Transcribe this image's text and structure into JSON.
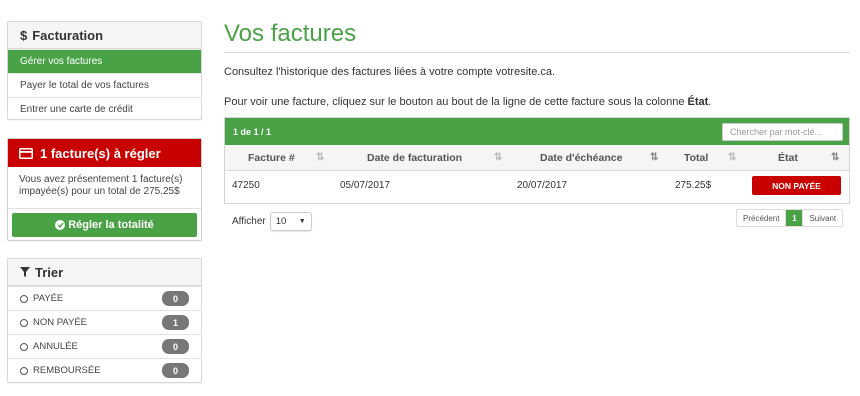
{
  "sidebar": {
    "billing": {
      "title": "Facturation",
      "items": [
        {
          "label": "Gérer vos factures",
          "active": true
        },
        {
          "label": "Payer le total de vos factures",
          "active": false
        },
        {
          "label": "Entrer une carte de crédit",
          "active": false
        }
      ]
    },
    "due": {
      "title": "1 facture(s) à régler",
      "message": "Vous avez présentement 1 facture(s) impayée(s) pour un total de 275.25$",
      "button_label": "Régler la totalité"
    },
    "filter": {
      "title": "Trier",
      "items": [
        {
          "label": "PAYÉE",
          "count": "0"
        },
        {
          "label": "NON PAYÉE",
          "count": "1"
        },
        {
          "label": "ANNULÉE",
          "count": "0"
        },
        {
          "label": "REMBOURSÉE",
          "count": "0"
        }
      ]
    }
  },
  "main": {
    "title": "Vos factures",
    "intro": "Consultez l'historique des factures liées à votre compte votresite.ca.",
    "instruction_prefix": "Pour voir une facture, cliquez sur le bouton au bout de la ligne de cette facture sous la colonne ",
    "instruction_bold": "État",
    "instruction_suffix": ".",
    "table": {
      "count_text": "1 de 1 / 1",
      "search_placeholder": "Chercher par mot-clé...",
      "headers": {
        "invoice": "Facture #",
        "billing_date": "Date de facturation",
        "due_date": "Date d'échéance",
        "total": "Total",
        "status": "État"
      },
      "rows": [
        {
          "invoice": "47250",
          "billing_date": "05/07/2017",
          "due_date": "20/07/2017",
          "total": "275.25$",
          "status": "NON PAYÉE"
        }
      ]
    },
    "page_size_label": "Afficher",
    "page_size_value": "10",
    "pagination": {
      "prev": "Précédent",
      "current": "1",
      "next": "Suivant"
    }
  },
  "colors": {
    "accent": "#4aa246",
    "danger": "#c80000",
    "badge": "#777777"
  }
}
